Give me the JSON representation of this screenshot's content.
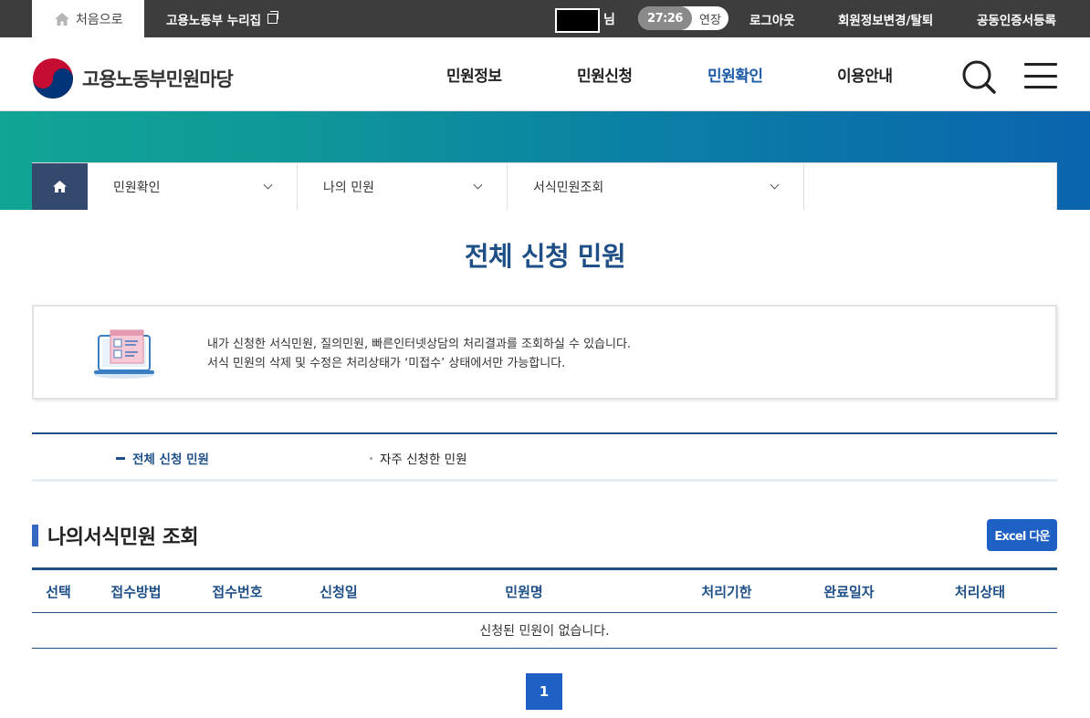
{
  "topbar": {
    "home_label": "처음으로",
    "nuri_label": "고용노동부 누리집",
    "user_suffix": "님",
    "session_time": "27:26",
    "session_extend": "연장",
    "logout": "로그아웃",
    "member_edit": "회원정보변경/탈퇴",
    "cert_register": "공동인증서등록"
  },
  "header": {
    "logo_text": "고용노동부민원마당",
    "nav": [
      "민원정보",
      "민원신청",
      "민원확인",
      "이용안내"
    ],
    "active_nav": "민원확인"
  },
  "location": {
    "segments": [
      "민원확인",
      "나의 민원",
      "서식민원조회"
    ]
  },
  "page": {
    "title": "전체 신청 민원"
  },
  "info": {
    "line1": "내가 신청한 서식민원, 질의민원, 빠른인터넷상담의 처리결과를 조회하실 수 있습니다.",
    "line2": "서식 민원의 삭제 및 수정은 처리상태가 ‘미접수’ 상태에서만 가능합니다."
  },
  "subtabs": [
    {
      "label": "전체 신청 민원",
      "active": true
    },
    {
      "label": "자주 신청한 민원",
      "active": false
    }
  ],
  "section": {
    "title": "나의서식민원 조회",
    "excel_label": "Excel 다운"
  },
  "table": {
    "headers": [
      "선택",
      "접수방법",
      "접수번호",
      "신청일",
      "민원명",
      "처리기한",
      "완료일자",
      "처리상태"
    ],
    "empty_message": "신청된 민원이 없습니다."
  },
  "pagination": {
    "current": "1"
  },
  "colors": {
    "primary_navy": "#1e4f86",
    "button_blue": "#1e60c4",
    "topbar_bg": "#3d3d3d",
    "banner_start": "#10a595",
    "banner_end": "#0b64ae"
  }
}
